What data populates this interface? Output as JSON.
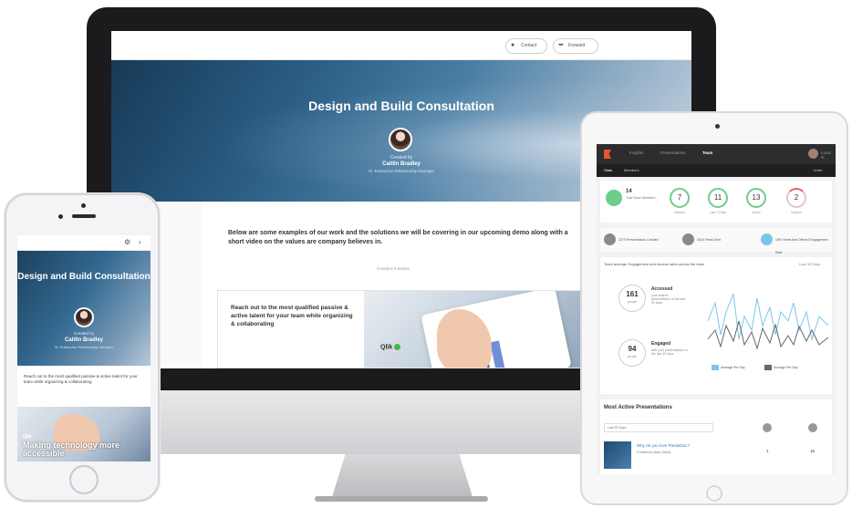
{
  "desktop": {
    "topbar": {
      "contact_label": "Contact",
      "forward_label": "Forward"
    },
    "hero": {
      "title": "Design and Build Consultation",
      "created_by": "Created by",
      "author": "Caitlin Bradley",
      "role": "Sr. Enterprise Relationship Manager"
    },
    "intro_text": "Below are some examples of our work and the solutions we will be covering in our upcoming demo along with a short video on the values are company believes in.",
    "contains": "Contains 5 assets",
    "card": {
      "text": "Reach out to the most qualified passive & active talent for your team while organizing & collaborating",
      "brand": "Qlik"
    }
  },
  "phone": {
    "hero": {
      "title": "Design and Build Consultation",
      "created_by": "Created by",
      "author": "Caitlin Bradley",
      "role": "Sr. Enterprise Relationship Manager"
    },
    "text": "Reach out to the most qualified passive & active talent for your team while organizing & collaborating",
    "brand": "Qlik",
    "overlay": "Making technology more accessible"
  },
  "tablet": {
    "nav": {
      "items": [
        "Insights",
        "Presentations",
        "Team"
      ],
      "active": "Team",
      "user": "Louis G."
    },
    "subnav": {
      "items": [
        "Stats",
        "Members"
      ],
      "right": "Invite"
    },
    "stats": {
      "first": {
        "value": "14",
        "label": "Total Team Members"
      },
      "rings": [
        {
          "value": "7",
          "label": "Admins"
        },
        {
          "value": "11",
          "label": "Last 7 Days"
        },
        {
          "value": "13",
          "label": "Active"
        },
        {
          "value": "2",
          "label": "Inactive"
        }
      ]
    },
    "chips": [
      {
        "label": "2279 Presentations Created"
      },
      {
        "label": "3024 Views Sent"
      },
      {
        "label": "18% Views that Offered Engagement Rate"
      }
    ],
    "engagement": {
      "title": "Team average Engagement and Access rates across the team",
      "filter": "Last 30 Days",
      "accessed": {
        "value": "161",
        "unit": "people",
        "label": "Accessed",
        "sub": "your shared presentations in the last 30 days"
      },
      "engaged": {
        "value": "94",
        "unit": "people",
        "label": "Engaged",
        "sub": "with your presentations in the last 30 days"
      },
      "legend": [
        "Average Per Day",
        "Average Per Day"
      ]
    },
    "most_active": {
      "title": "Most Active Presentations",
      "filter": "Last 30 Days",
      "row": {
        "title": "Why do you love PandaDoc?",
        "by": "Created by Mark Collins",
        "sub": "Created in 5/20/2016",
        "views": "1",
        "shares": "16"
      }
    }
  },
  "colors": {
    "accent_green": "#6fcd8a",
    "accent_blue": "#7cc6ea",
    "brand_orange": "#e8542c"
  }
}
